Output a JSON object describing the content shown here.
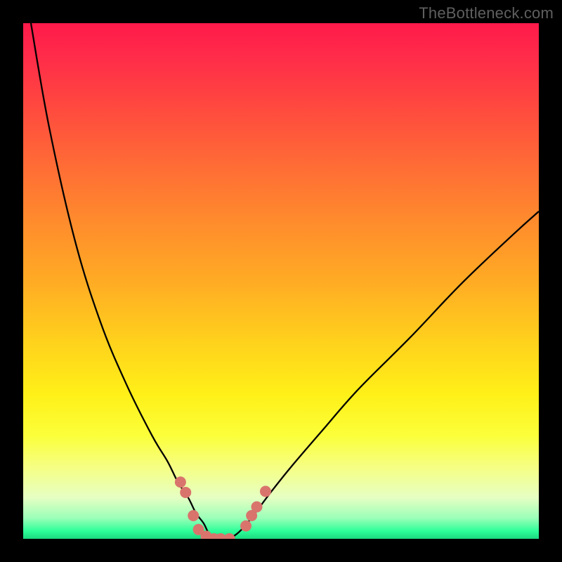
{
  "watermark": "TheBottleneck.com",
  "chart_data": {
    "type": "line",
    "title": "",
    "xlabel": "",
    "ylabel": "",
    "x_range": [
      0,
      100
    ],
    "y_range": [
      0,
      100
    ],
    "background_gradient": {
      "type": "vertical",
      "stops": [
        {
          "color": "#ff1a4a",
          "pos": 0
        },
        {
          "color": "#ffd21c",
          "pos": 62
        },
        {
          "color": "#fff018",
          "pos": 72
        },
        {
          "color": "#1cd880",
          "pos": 100
        }
      ],
      "meaning": "top=bad (red), bottom=good (green)"
    },
    "series": [
      {
        "name": "left-branch",
        "x": [
          1.5,
          5,
          10,
          15,
          20,
          25,
          28,
          30,
          32,
          33.5,
          35,
          36,
          37
        ],
        "y": [
          0,
          20,
          42,
          58,
          70,
          80,
          85,
          89,
          92,
          95,
          97,
          99,
          100
        ],
        "note": "y is plotted from top (0) to bottom (100)"
      },
      {
        "name": "right-branch",
        "x": [
          40,
          41.5,
          43,
          45,
          48,
          52,
          58,
          65,
          75,
          85,
          95,
          100
        ],
        "y": [
          100,
          99,
          97.5,
          95,
          91,
          86,
          79,
          71,
          61,
          50.5,
          41,
          36.5
        ],
        "note": "y is plotted from top (0) to bottom (100)"
      }
    ],
    "markers": {
      "name": "bottom-dots",
      "color": "#d9746d",
      "radius_px": 8,
      "points": [
        {
          "x": 30.5,
          "y": 89.0
        },
        {
          "x": 31.5,
          "y": 91.0
        },
        {
          "x": 33.0,
          "y": 95.5
        },
        {
          "x": 34.0,
          "y": 98.2
        },
        {
          "x": 35.5,
          "y": 99.5
        },
        {
          "x": 37.0,
          "y": 100.0
        },
        {
          "x": 38.3,
          "y": 100.0
        },
        {
          "x": 40.0,
          "y": 100.0
        },
        {
          "x": 43.2,
          "y": 97.5
        },
        {
          "x": 44.3,
          "y": 95.5
        },
        {
          "x": 45.3,
          "y": 93.8
        },
        {
          "x": 47.0,
          "y": 90.8
        }
      ]
    }
  }
}
